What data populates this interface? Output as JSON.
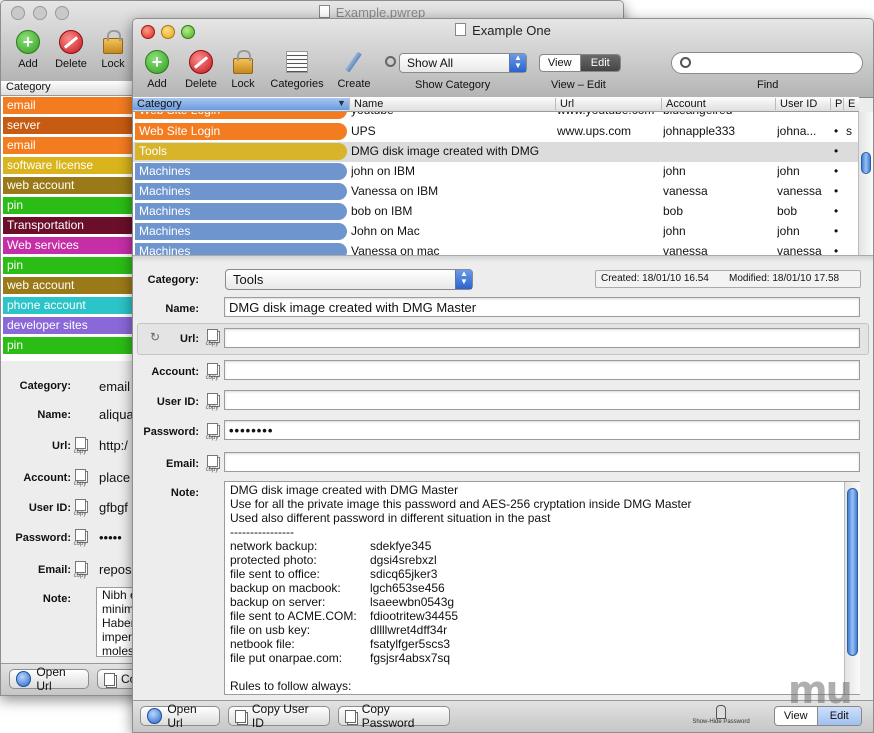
{
  "back_window": {
    "title": "Example.pwrep",
    "toolbar": {
      "add": "Add",
      "delete": "Delete",
      "lock": "Lock"
    },
    "column_header": "Category",
    "categories": [
      {
        "label": "email",
        "color": "#f47c20"
      },
      {
        "label": "server",
        "color": "#c75b12"
      },
      {
        "label": "email",
        "color": "#f47c20"
      },
      {
        "label": "software license",
        "color": "#d9b41c"
      },
      {
        "label": "web account",
        "color": "#9a7a18"
      },
      {
        "label": "pin",
        "color": "#2bbd16"
      },
      {
        "label": "Transportation",
        "color": "#6b0e2a"
      },
      {
        "label": "Web services",
        "color": "#c62ea8"
      },
      {
        "label": "pin",
        "color": "#2bbd16"
      },
      {
        "label": "web account",
        "color": "#9a7a18"
      },
      {
        "label": "phone account",
        "color": "#2bc4c8"
      },
      {
        "label": "developer sites",
        "color": "#8a68d8"
      },
      {
        "label": "pin",
        "color": "#2bbd16"
      }
    ],
    "fields": {
      "category_label": "Category:",
      "category_value": "email",
      "name_label": "Name:",
      "name_value": "aliqua",
      "url_label": "Url:",
      "url_value": "http:/",
      "account_label": "Account:",
      "account_value": "place",
      "userid_label": "User ID:",
      "userid_value": "gfbgf",
      "password_label": "Password:",
      "password_value": "•••••",
      "email_label": "Email:",
      "email_value": "repos",
      "note_label": "Note:",
      "note_lines": [
        "Nibh e",
        "minim",
        "Haber",
        "imper",
        "moles"
      ]
    },
    "buttons": {
      "open_url": "Open Url",
      "copy_partial": "Co"
    }
  },
  "front_window": {
    "title": "Example One",
    "toolbar": {
      "add": "Add",
      "delete": "Delete",
      "lock": "Lock",
      "categories": "Categories",
      "create": "Create",
      "show_category_value": "Show All",
      "show_category_label": "Show Category",
      "view": "View",
      "edit": "Edit",
      "view_edit_label": "View – Edit",
      "find_label": "Find",
      "find_placeholder": ""
    },
    "columns": [
      "Category",
      "Name",
      "Url",
      "Account",
      "User ID",
      "P",
      "E"
    ],
    "rows": [
      {
        "category": "Web Site Login",
        "color": "#f47c20",
        "name": "youtube",
        "url": "www.youtube.com",
        "account": "blueangelred",
        "userid": "",
        "p": "",
        "e": ""
      },
      {
        "category": "Web Site Login",
        "color": "#f47c20",
        "name": "UPS",
        "url": "www.ups.com",
        "account": "johnapple333",
        "userid": "johna...",
        "p": "•",
        "e": "s"
      },
      {
        "category": "Tools",
        "color": "#d8b42a",
        "name": "DMG disk image created with DMG",
        "url": "",
        "account": "",
        "userid": "",
        "p": "•",
        "e": ""
      },
      {
        "category": "Machines",
        "color": "#6f95cf",
        "name": "john on IBM",
        "url": "",
        "account": "john",
        "userid": "john",
        "p": "•",
        "e": ""
      },
      {
        "category": "Machines",
        "color": "#6f95cf",
        "name": "Vanessa on IBM",
        "url": "",
        "account": "vanessa",
        "userid": "vanessa",
        "p": "•",
        "e": ""
      },
      {
        "category": "Machines",
        "color": "#6f95cf",
        "name": "bob on IBM",
        "url": "",
        "account": "bob",
        "userid": "bob",
        "p": "•",
        "e": ""
      },
      {
        "category": "Machines",
        "color": "#6f95cf",
        "name": "John on Mac",
        "url": "",
        "account": "john",
        "userid": "john",
        "p": "•",
        "e": ""
      },
      {
        "category": "Machines",
        "color": "#6f95cf",
        "name": "Vanessa on mac",
        "url": "",
        "account": "vanessa",
        "userid": "vanessa",
        "p": "•",
        "e": ""
      }
    ],
    "detail": {
      "category_label": "Category:",
      "category_value": "Tools",
      "created": "Created: 18/01/10 16.54",
      "modified": "Modified: 18/01/10 17.58",
      "name_label": "Name:",
      "name_value": "DMG disk image created with DMG Master",
      "url_label": "Url:",
      "url_value": "",
      "account_label": "Account:",
      "account_value": "",
      "userid_label": "User ID:",
      "userid_value": "",
      "password_label": "Password:",
      "password_value": "••••••••",
      "email_label": "Email:",
      "email_value": "",
      "copy_label": "copy",
      "note_label": "Note:",
      "note_intro": [
        "DMG disk image created with DMG Master",
        "Use for all the private image this password and AES-256 cryptation inside DMG Master",
        "Used also different password in different situation in the past",
        "----------------"
      ],
      "note_pairs": [
        {
          "k": "network backup:",
          "v": "sdekfye345"
        },
        {
          "k": "protected photo:",
          "v": "dgsi4srebxzl"
        },
        {
          "k": "file sent to office:",
          "v": "sdicq65jker3"
        },
        {
          "k": "backup on macbook:",
          "v": "lgch653se456"
        },
        {
          "k": "backup on server:",
          "v": "lsaeewbn0543g"
        },
        {
          "k": "file sent to ACME.COM:",
          "v": "fdiootritew34455"
        },
        {
          "k": "file on usb key:",
          "v": "dllllwret4dff34r"
        },
        {
          "k": "netbook file:",
          "v": "fsatylfger5scs3"
        },
        {
          "k": "file put onarpae.com:",
          "v": "fgsjsr4absx7sq"
        }
      ],
      "note_outro": [
        "",
        "Rules to follow always:"
      ]
    },
    "buttons": {
      "open_url": "Open Url",
      "copy_userid": "Copy User ID",
      "copy_password": "Copy Password",
      "show_hide_password": "Show-Hide Password",
      "view": "View",
      "edit": "Edit"
    }
  },
  "watermark": "mu"
}
